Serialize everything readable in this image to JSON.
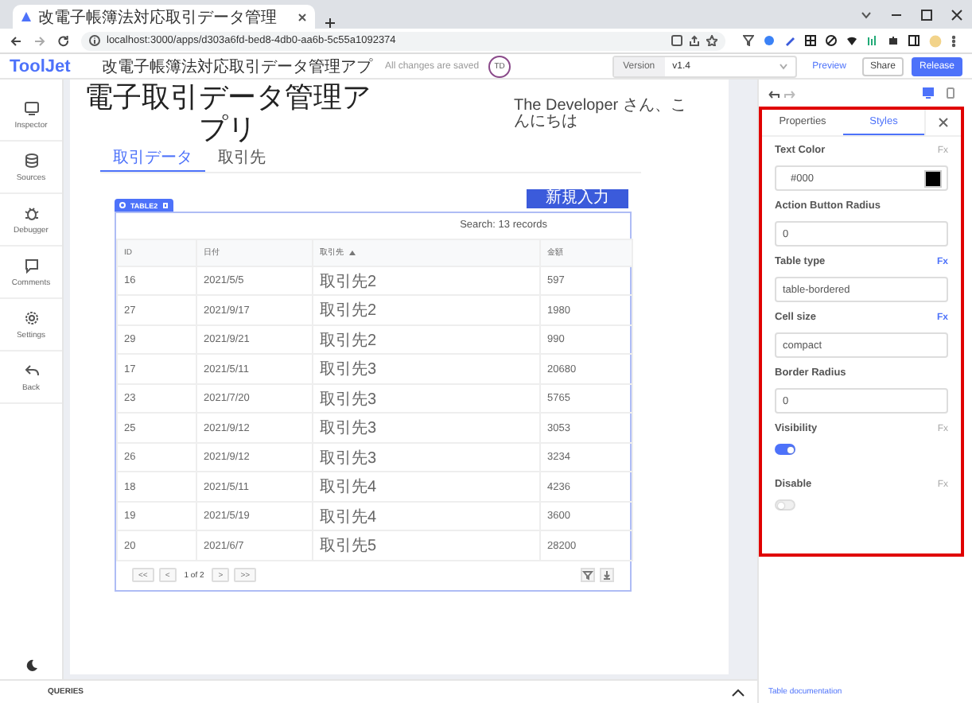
{
  "browser": {
    "tab_title": "改電子帳簿法対応取引データ管理",
    "url": "localhost:3000/apps/d303a6fd-bed8-4db0-aa6b-5c55a1092374"
  },
  "header": {
    "logo": "ToolJet",
    "app_name": "改電子帳簿法対応取引データ管理アプ",
    "save_status": "All changes are saved",
    "avatar": "TD",
    "version_label": "Version",
    "version": "v1.4",
    "buttons": [
      {
        "label": "Preview",
        "kind": "link"
      },
      {
        "label": "Share",
        "kind": "outline"
      },
      {
        "label": "Release",
        "kind": "primary"
      }
    ]
  },
  "sidebar": {
    "items": [
      {
        "label": "Inspector",
        "kind": "inspector"
      },
      {
        "label": "Sources",
        "kind": "sources"
      },
      {
        "label": "Debugger",
        "kind": "debugger"
      },
      {
        "label": "Comments",
        "kind": "comments"
      },
      {
        "label": "Settings",
        "kind": "settings"
      },
      {
        "label": "Back",
        "kind": "back"
      }
    ]
  },
  "canvas": {
    "title": "電子取引データ管理アプリ",
    "greeting": "The Developer さん、こんにちは",
    "tabs": [
      {
        "label": "取引データ",
        "selected": true
      },
      {
        "label": "取引先",
        "selected": false
      }
    ],
    "new_button": "新規入力",
    "table": {
      "widget_label": "TABLE2",
      "search": "Search: 13 records",
      "columns": [
        {
          "label": "ID",
          "sorted": false
        },
        {
          "label": "日付",
          "sorted": false
        },
        {
          "label": "取引先",
          "sorted": true
        },
        {
          "label": "金額",
          "sorted": false
        }
      ],
      "rows": [
        [
          "16",
          "2021/5/5",
          "取引先2",
          "597"
        ],
        [
          "27",
          "2021/9/17",
          "取引先2",
          "1980"
        ],
        [
          "29",
          "2021/9/21",
          "取引先2",
          "990"
        ],
        [
          "17",
          "2021/5/11",
          "取引先3",
          "20680"
        ],
        [
          "23",
          "2021/7/20",
          "取引先3",
          "5765"
        ],
        [
          "25",
          "2021/9/12",
          "取引先3",
          "3053"
        ],
        [
          "26",
          "2021/9/12",
          "取引先3",
          "3234"
        ],
        [
          "18",
          "2021/5/11",
          "取引先4",
          "4236"
        ],
        [
          "19",
          "2021/5/19",
          "取引先4",
          "3600"
        ],
        [
          "20",
          "2021/6/7",
          "取引先5",
          "28200"
        ]
      ],
      "pager_buttons": [
        "<<",
        "<",
        ">",
        ">>"
      ],
      "page_info": "1 of 2"
    }
  },
  "inspector": {
    "tabs": [
      {
        "label": "Properties",
        "selected": false
      },
      {
        "label": "Styles",
        "selected": true
      }
    ],
    "fields": [
      {
        "kind": "color",
        "label": "Text Color",
        "fx": {
          "label": "Fx",
          "active": false
        },
        "value": "#000",
        "color": "#000000"
      },
      {
        "kind": "input",
        "label": "Action Button Radius",
        "value": "0"
      },
      {
        "kind": "input",
        "label": "Table type",
        "fx": {
          "label": "Fx",
          "active": true
        },
        "value": "table-bordered"
      },
      {
        "kind": "input",
        "label": "Cell size",
        "fx": {
          "label": "Fx",
          "active": true
        },
        "value": "compact"
      },
      {
        "kind": "input",
        "label": "Border Radius",
        "value": "0"
      },
      {
        "kind": "toggle",
        "label": "Visibility",
        "fx": {
          "label": "Fx",
          "active": false
        },
        "on": true
      },
      {
        "kind": "toggle",
        "label": "Disable",
        "fx": {
          "label": "Fx",
          "active": false
        },
        "on": false
      }
    ],
    "documentation_link": "Table documentation"
  },
  "queries": {
    "label": "QUERIES"
  }
}
